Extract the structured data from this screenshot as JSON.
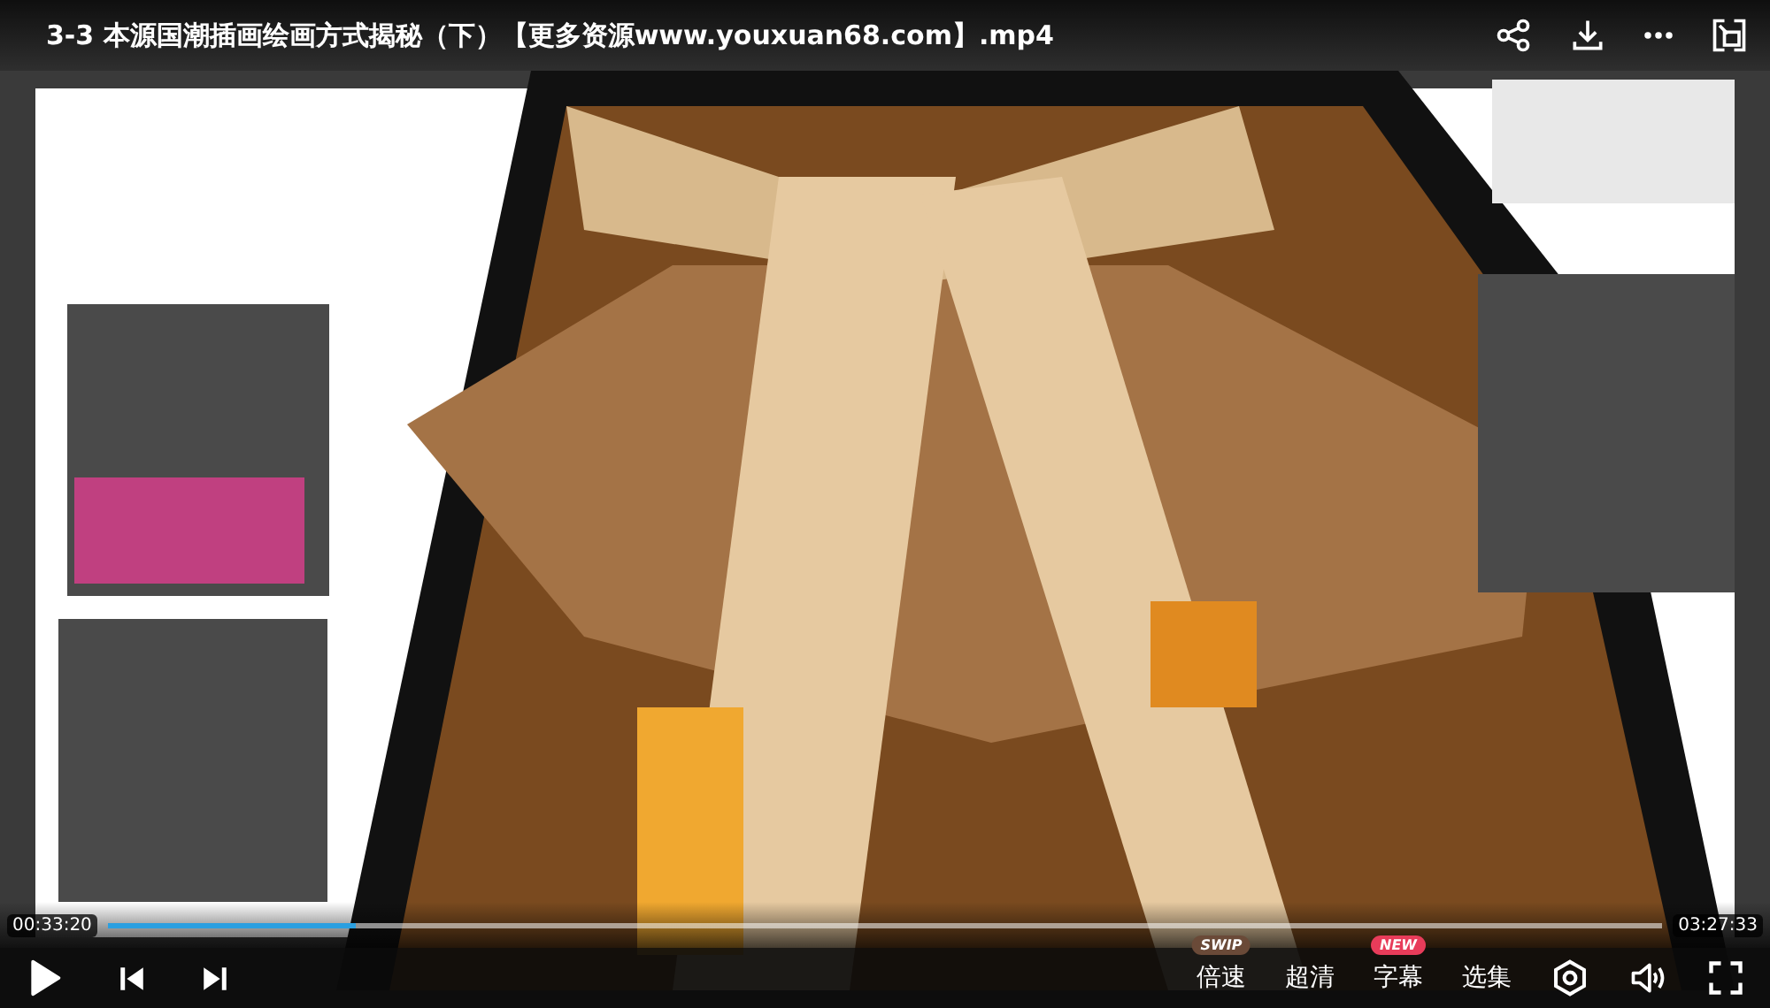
{
  "title": "3-3 本源国潮插画绘画方式揭秘（下）【更多资源www.youxuan68.com】.mp4",
  "progress": {
    "current": "00:33:20",
    "total": "03:27:33",
    "level": 0.16
  },
  "controls": [
    {
      "label": "倍速",
      "badge": "SWIP",
      "color": "#6a4a38"
    },
    {
      "label": "超清"
    },
    {
      "label": "字幕",
      "badge": "NEW",
      "color": "#e83c5a"
    },
    {
      "label": "选集"
    }
  ]
}
